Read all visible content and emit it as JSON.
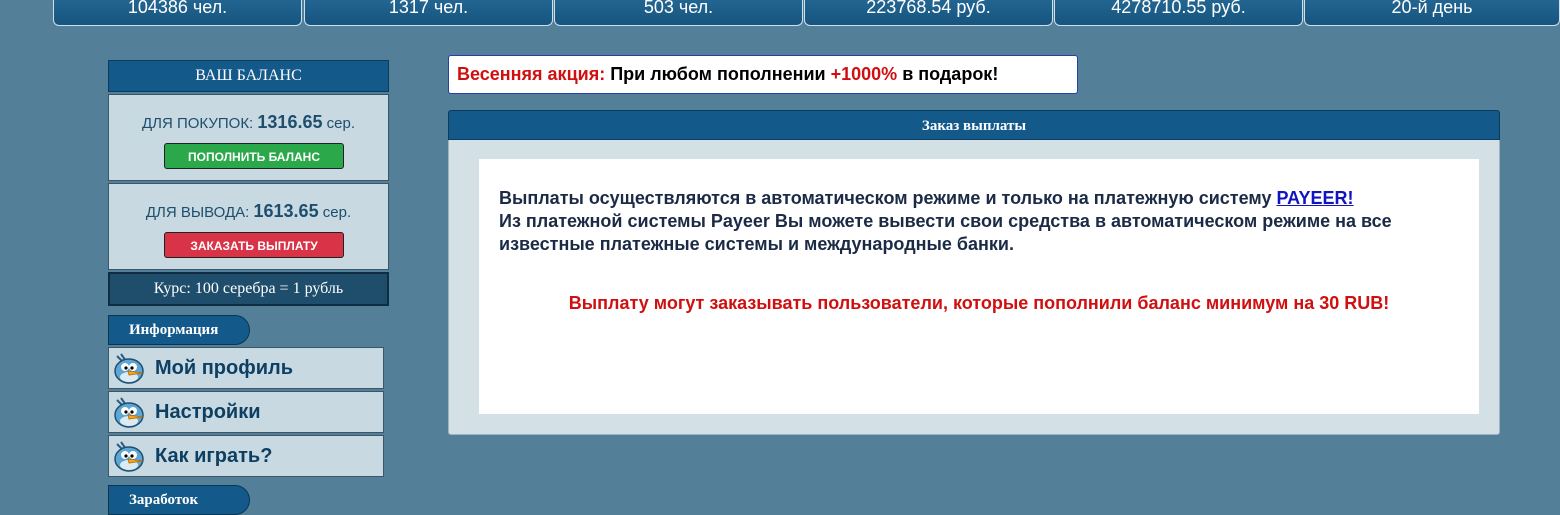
{
  "stats": [
    "104386 чел.",
    "1317 чел.",
    "503 чел.",
    "223768.54 руб.",
    "4278710.55 руб.",
    "20-й день"
  ],
  "balance": {
    "title": "ВАШ БАЛАНС",
    "buy_label": "ДЛЯ ПОКУПОК:",
    "buy_value": "1316.65",
    "buy_unit": "сер.",
    "topup_button": "ПОПОЛНИТЬ БАЛАНС",
    "withdraw_label": "ДЛЯ ВЫВОДА:",
    "withdraw_value": "1613.65",
    "withdraw_unit": "сер.",
    "withdraw_button": "ЗАКАЗАТЬ ВЫПЛАТУ",
    "rate": "Курс: 100 серебра = 1 рубль"
  },
  "sections": {
    "info_title": "Информация",
    "earn_title": "Заработок"
  },
  "menu": [
    {
      "label": "Мой профиль",
      "icon": "bird-icon"
    },
    {
      "label": "Настройки",
      "icon": "bird-icon"
    },
    {
      "label": "Как играть?",
      "icon": "bird-icon"
    }
  ],
  "promo": {
    "prefix": "Весенняя акция:",
    "text": "При любом пополнении",
    "highlight": "+1000%",
    "suffix": "в подарок!"
  },
  "panel": {
    "title": "Заказ выплаты",
    "line1": "Выплаты осуществляются в автоматическом режиме и только на платежную систему",
    "link": "PAYEER!",
    "line2": "Из платежной системы Payeer Вы можете вывести свои средства в автоматическом режиме на все известные платежные системы и международные банки.",
    "warning": "Выплату могут заказывать пользователи, которые пополнили баланс минимум на 30 RUB!"
  },
  "colors": {
    "background": "#537f99",
    "header_blue": "#13598a",
    "accent_red": "#d01010",
    "button_green": "#2aa84a",
    "button_red": "#d83346"
  }
}
